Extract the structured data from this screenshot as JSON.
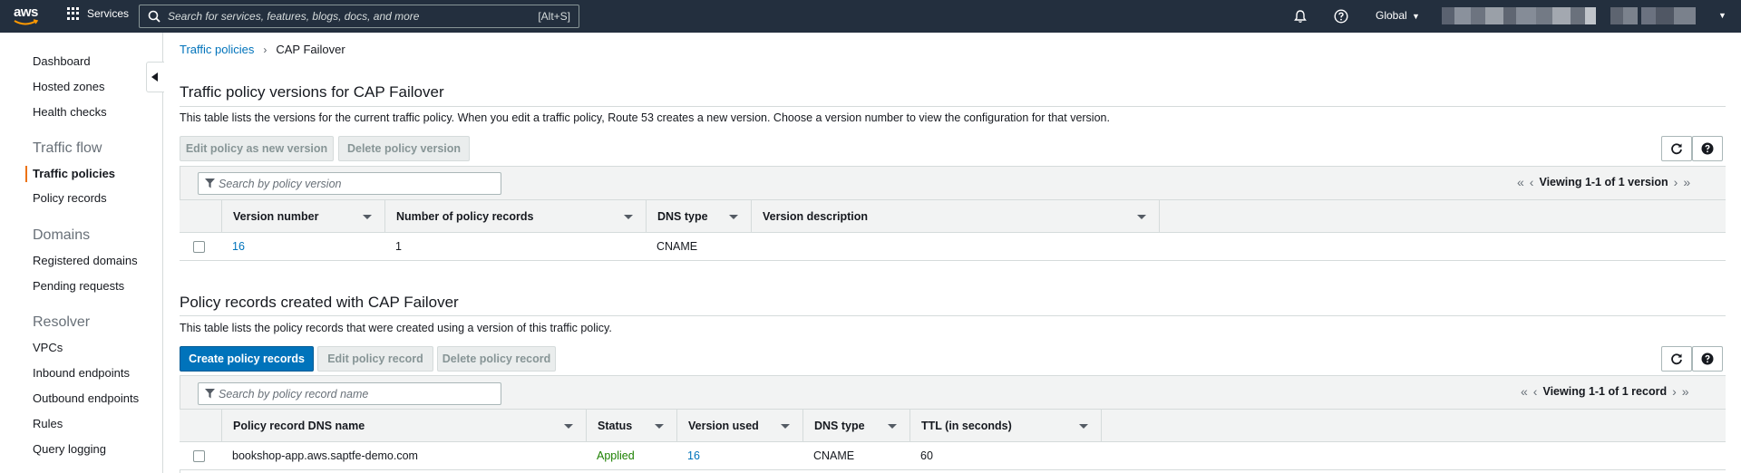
{
  "topnav": {
    "logo": "aws",
    "services_label": "Services",
    "search_placeholder": "Search for services, features, blogs, docs, and more",
    "search_shortcut": "[Alt+S]",
    "region_label": "Global"
  },
  "sidebar": {
    "items_top": [
      "Dashboard",
      "Hosted zones",
      "Health checks"
    ],
    "traffic_flow_heading": "Traffic flow",
    "traffic_flow_items": [
      "Traffic policies",
      "Policy records"
    ],
    "domains_heading": "Domains",
    "domains_items": [
      "Registered domains",
      "Pending requests"
    ],
    "resolver_heading": "Resolver",
    "resolver_items": [
      "VPCs",
      "Inbound endpoints",
      "Outbound endpoints",
      "Rules",
      "Query logging"
    ]
  },
  "breadcrumb": {
    "root": "Traffic policies",
    "current": "CAP Failover"
  },
  "versions": {
    "title": "Traffic policy versions for CAP Failover",
    "description": "This table lists the versions for the current traffic policy. When you edit a traffic policy, Route 53 creates a new version. Choose a version number to view the configuration for that version.",
    "btn_edit": "Edit policy as new version",
    "btn_delete": "Delete policy version",
    "filter_placeholder": "Search by policy version",
    "pager": "Viewing 1-1 of 1 version",
    "columns": [
      "Version number",
      "Number of policy records",
      "DNS type",
      "Version description"
    ],
    "rows": [
      {
        "version": "16",
        "records": "1",
        "dns_type": "CNAME",
        "description": ""
      }
    ]
  },
  "records": {
    "title": "Policy records created with CAP Failover",
    "description": "This table lists the policy records that were created using a version of this traffic policy.",
    "btn_create": "Create policy records",
    "btn_edit": "Edit policy record",
    "btn_delete": "Delete policy record",
    "filter_placeholder": "Search by policy record name",
    "pager": "Viewing 1-1 of 1 record",
    "columns": [
      "Policy record DNS name",
      "Status",
      "Version used",
      "DNS type",
      "TTL (in seconds)"
    ],
    "rows": [
      {
        "dns_name": "bookshop-app.aws.saptfe-demo.com",
        "status": "Applied",
        "version": "16",
        "dns_type": "CNAME",
        "ttl": "60"
      }
    ]
  },
  "colors": {
    "nav_bg": "#232f3e",
    "link": "#0073bb",
    "primary": "#0073bb",
    "success": "#1d8102",
    "active_marker": "#ec7211"
  }
}
